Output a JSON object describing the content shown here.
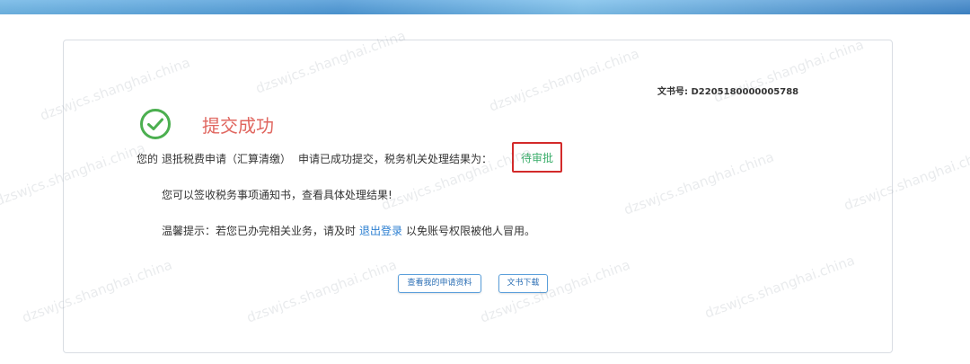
{
  "doc_number": "文书号: D2205180000005788",
  "success": {
    "title": "提交成功",
    "icon": "check-circle-icon",
    "color": "#e0665f",
    "icon_color": "#4caf50"
  },
  "result_line": {
    "prefix": "您的",
    "application": "退抵税费申请（汇算清缴）",
    "mid": "申请已成功提交，税务机关处理结果为：",
    "status": "待审批",
    "status_color": "#3bae6b",
    "highlight_color": "#d32a2a"
  },
  "notice_line": "您可以签收税务事项通知书，查看具体处理结果!",
  "tip_line": {
    "prefix": "温馨提示：若您已办完相关业务，请及时",
    "link": "退出登录",
    "suffix": "以免账号权限被他人冒用。"
  },
  "buttons": {
    "view_application": "查看我的申请资料",
    "download_document": "文书下载"
  },
  "watermark_text": "dzswjcs.shanghai.china"
}
